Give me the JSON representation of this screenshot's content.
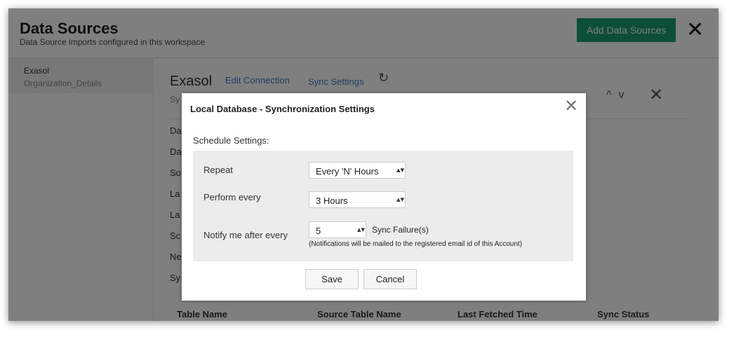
{
  "header": {
    "title": "Data Sources",
    "subtitle": "Data Source imports configured in this workspace",
    "add_button": "Add Data Sources",
    "close_glyph": "✕"
  },
  "sidebar": {
    "items": [
      {
        "name": "Exasol",
        "table": "Organization_Details"
      }
    ]
  },
  "main": {
    "title": "Exasol",
    "tabs": {
      "edit": "Edit Connection",
      "sync": "Sync Settings"
    },
    "refresh_glyph": "↻",
    "sub_label": "Sy",
    "properties": [
      "Da",
      "Da",
      "So",
      "La",
      "La",
      "Sc",
      "Ne",
      "Sy"
    ],
    "nav_up": "^",
    "nav_down": "v",
    "nav_close": "✕",
    "table_headers": [
      "Table Name",
      "Source Table Name",
      "Last Fetched Time",
      "Sync Status"
    ]
  },
  "modal": {
    "title": "Local Database - Synchronization Settings",
    "close_glyph": "✕",
    "schedule_label": "Schedule Settings:",
    "repeat_label": "Repeat",
    "repeat_value": "Every 'N' Hours",
    "perform_label": "Perform every",
    "perform_value": "3 Hours",
    "notify_label": "Notify me after every",
    "notify_value": "5",
    "sync_failure": "Sync Failure(s)",
    "note": "(Notifications will be mailed to the registered email id of this Account)",
    "save": "Save",
    "cancel": "Cancel",
    "select_arrows": "▴▾"
  }
}
